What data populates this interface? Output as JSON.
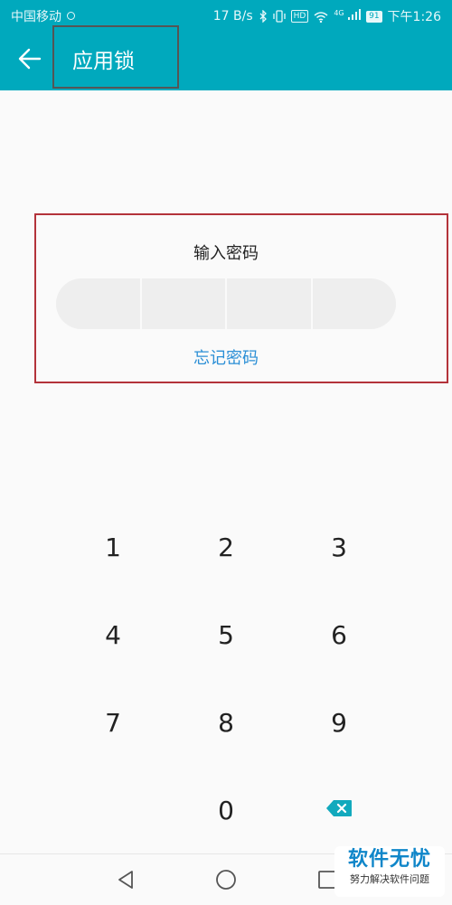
{
  "status_bar": {
    "carrier": "中国移动",
    "speed": "17 B/s",
    "hd_badge": "HD",
    "network": "4G",
    "battery": "91",
    "time": "下午1:26"
  },
  "app_bar": {
    "title": "应用锁",
    "back_icon": "arrow-left-icon"
  },
  "lock": {
    "prompt": "输入密码",
    "forgot": "忘记密码",
    "pin_cells": 4
  },
  "keypad": {
    "digits": [
      "1",
      "2",
      "3",
      "4",
      "5",
      "6",
      "7",
      "8",
      "9",
      "0"
    ],
    "backspace_icon": "backspace-icon",
    "accent_color": "#12a9bd"
  },
  "nav_bar": {
    "back_icon": "nav-back-icon",
    "home_icon": "nav-home-icon",
    "recents_icon": "nav-recents-icon"
  },
  "watermark": {
    "main": "软件无忧",
    "sub": "努力解决软件问题"
  },
  "colors": {
    "primary": "#00a9bd",
    "link": "#2b8fd6",
    "annotation_red": "#b3333a"
  }
}
